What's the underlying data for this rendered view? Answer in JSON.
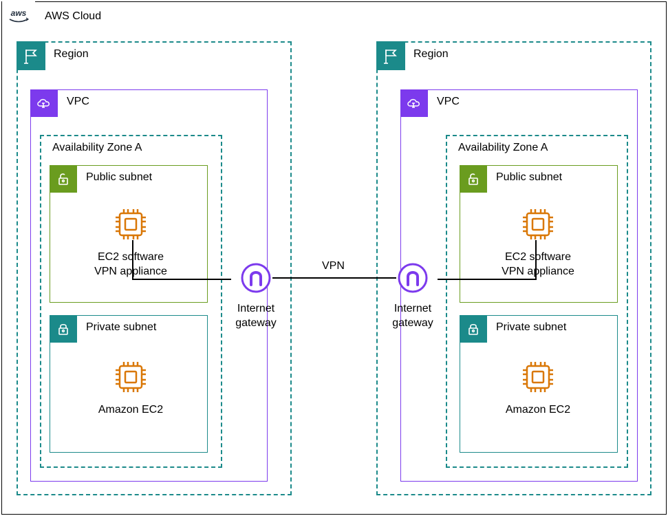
{
  "cloud": {
    "label": "AWS Cloud"
  },
  "regions": [
    {
      "label": "Region"
    },
    {
      "label": "Region"
    }
  ],
  "vpc": {
    "label": "VPC"
  },
  "az": {
    "label": "Availability Zone A"
  },
  "subnets": {
    "public_label": "Public subnet",
    "private_label": "Private subnet"
  },
  "resources": {
    "vpn_appliance_caption": "EC2 software\nVPN appliance",
    "ec2_caption": "Amazon EC2"
  },
  "gateway": {
    "label": "Internet\ngateway"
  },
  "connection": {
    "label": "VPN"
  }
}
